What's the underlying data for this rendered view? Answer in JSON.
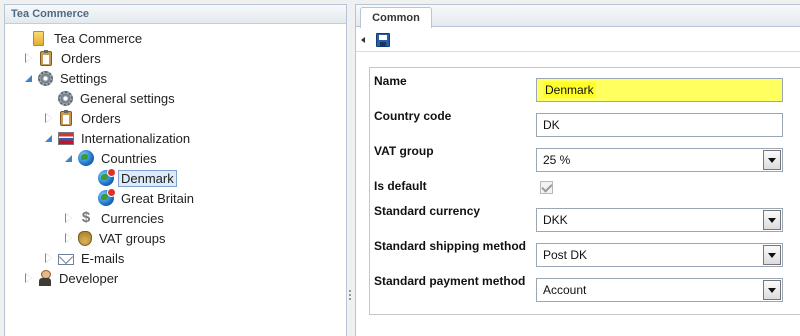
{
  "tree": {
    "header": "Tea Commerce",
    "nodes": [
      {
        "label": "Tea Commerce",
        "icon": "folder-icon",
        "expander": "none"
      },
      {
        "label": "Orders",
        "icon": "clipboard-icon",
        "expander": "collapsed"
      },
      {
        "label": "Settings",
        "icon": "gears-icon",
        "expander": "expanded"
      },
      {
        "label": "General settings",
        "icon": "gear-icon",
        "expander": "none"
      },
      {
        "label": "Orders",
        "icon": "clipboard-icon",
        "expander": "collapsed"
      },
      {
        "label": "Internationalization",
        "icon": "flags-icon",
        "expander": "expanded"
      },
      {
        "label": "Countries",
        "icon": "globe-icon",
        "expander": "expanded"
      },
      {
        "label": "Denmark",
        "icon": "globe-red-icon",
        "expander": "none",
        "selected": true
      },
      {
        "label": "Great Britain",
        "icon": "globe-red-icon",
        "expander": "none"
      },
      {
        "label": "Currencies",
        "icon": "dollar-icon",
        "expander": "collapsed"
      },
      {
        "label": "VAT groups",
        "icon": "money-bag-icon",
        "expander": "collapsed"
      },
      {
        "label": "E-mails",
        "icon": "envelope-icon",
        "expander": "collapsed"
      },
      {
        "label": "Developer",
        "icon": "developer-icon",
        "expander": "collapsed"
      }
    ]
  },
  "tabs": {
    "common": "Common"
  },
  "toolbar": {
    "save_icon": "save-icon"
  },
  "form": {
    "name_label": "Name",
    "name_value": "Denmark",
    "country_code_label": "Country code",
    "country_code_value": "DK",
    "vat_group_label": "VAT group",
    "vat_group_value": "25 %",
    "is_default_label": "Is default",
    "is_default_checked": true,
    "standard_currency_label": "Standard currency",
    "standard_currency_value": "DKK",
    "shipping_method_label": "Standard shipping method",
    "shipping_method_value": "Post DK",
    "payment_method_label": "Standard payment method",
    "payment_method_value": "Account"
  },
  "colors": {
    "highlight": "#ffff60",
    "selection": "#dcebfc",
    "border": "#b7c5d4",
    "header_text": "#4f6a86"
  }
}
